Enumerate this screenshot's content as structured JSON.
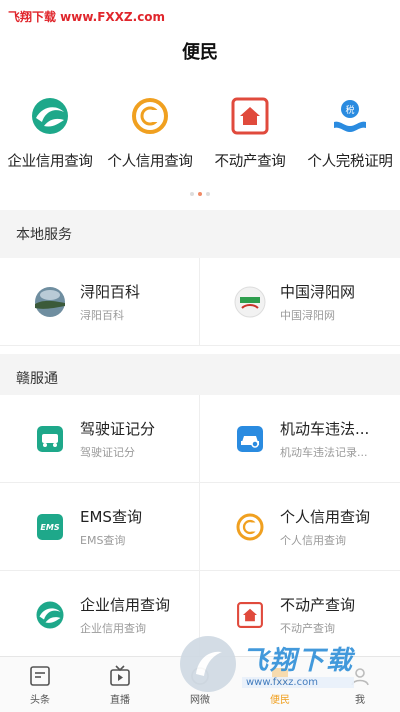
{
  "watermark_top": "飞翔下载 www.FXXZ.com",
  "page_title": "便民",
  "quick_items": [
    {
      "label": "企业信用查询",
      "icon": "enterprise-credit-icon",
      "color": "#1ea88a"
    },
    {
      "label": "个人信用查询",
      "icon": "personal-credit-icon",
      "color": "#f0a020"
    },
    {
      "label": "不动产查询",
      "icon": "house-icon",
      "color": "#e04a3c"
    },
    {
      "label": "个人完税证明",
      "icon": "tax-certificate-icon",
      "color": "#2a8be0"
    }
  ],
  "sections": {
    "local": {
      "title": "本地服务",
      "items": [
        {
          "title": "浔阳百科",
          "sub": "浔阳百科",
          "icon": "xunyang-baike-icon"
        },
        {
          "title": "中国浔阳网",
          "sub": "中国浔阳网",
          "icon": "xunyang-net-icon"
        }
      ]
    },
    "ganfutong": {
      "title": "赣服通",
      "items": [
        {
          "title": "驾驶证记分",
          "sub": "驾驶证记分",
          "icon": "driver-license-icon"
        },
        {
          "title": "机动车违法...",
          "sub": "机动车违法记录...",
          "icon": "vehicle-violation-icon"
        },
        {
          "title": "EMS查询",
          "sub": "EMS查询",
          "icon": "ems-icon"
        },
        {
          "title": "个人信用查询",
          "sub": "个人信用查询",
          "icon": "personal-credit-icon"
        },
        {
          "title": "企业信用查询",
          "sub": "企业信用查询",
          "icon": "enterprise-credit-icon"
        },
        {
          "title": "不动产查询",
          "sub": "不动产查询",
          "icon": "house-icon"
        }
      ]
    }
  },
  "tabs": [
    {
      "label": "头条",
      "icon": "headline-icon",
      "active": false
    },
    {
      "label": "直播",
      "icon": "live-tv-icon",
      "active": false
    },
    {
      "label": "网微",
      "icon": "web-micro-icon",
      "active": false
    },
    {
      "label": "便民",
      "icon": "service-icon",
      "active": true
    },
    {
      "label": "我",
      "icon": "me-icon",
      "active": false
    }
  ],
  "watermark_logo": {
    "cn": "飞翔下载",
    "url": "www.fxxz.com"
  },
  "colors": {
    "accent": "#f0a020",
    "section_bg": "#f4f4f4"
  }
}
